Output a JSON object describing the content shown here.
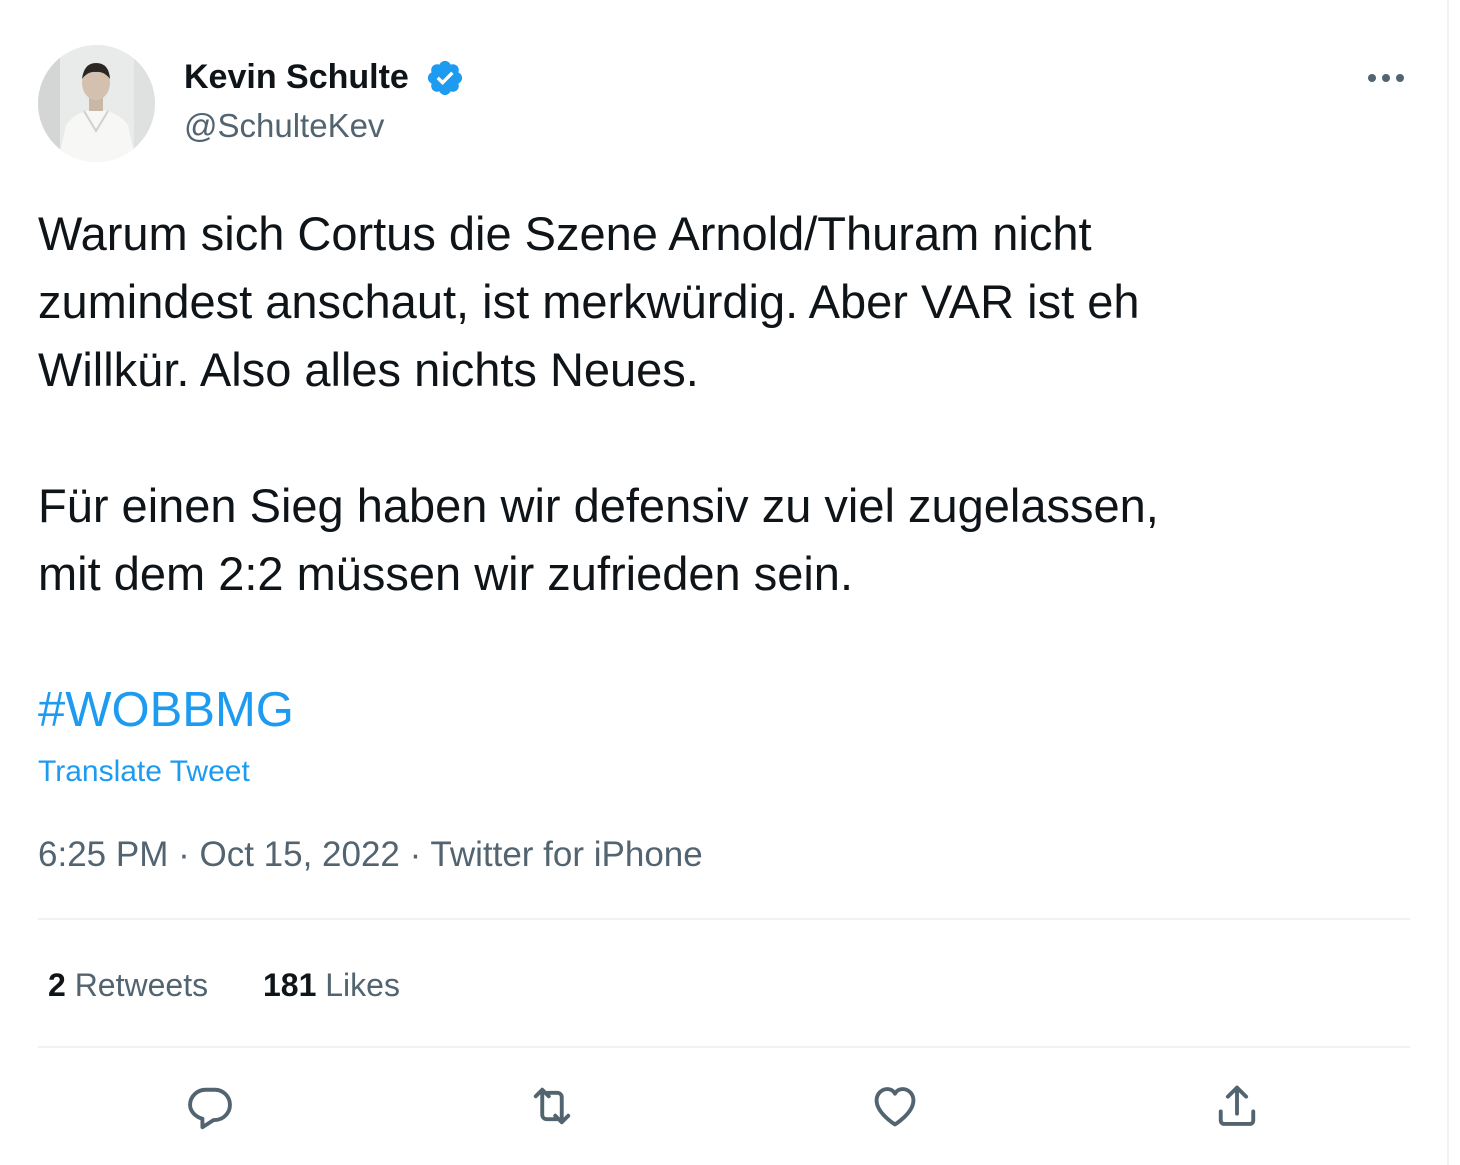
{
  "author": {
    "name": "Kevin Schulte",
    "handle": "@SchulteKev",
    "verified": true,
    "avatar_icon": "profile-photo"
  },
  "tweet": {
    "text": "Warum sich Cortus die Szene Arnold/Thuram nicht\nzumindest anschaut, ist merkwürdig. Aber VAR ist eh\nWillkür. Also alles nichts Neues.\n\nFür einen Sieg haben wir defensiv zu viel zugelassen,\nmit dem 2:2 müssen wir zufrieden sein.",
    "hashtag": "#WOBBMG",
    "translate_label": "Translate Tweet",
    "time": "6:25 PM",
    "date": "Oct 15, 2022",
    "source": "Twitter for iPhone",
    "separator": " · "
  },
  "stats": {
    "retweets_count": "2",
    "retweets_label": "Retweets",
    "likes_count": "181",
    "likes_label": "Likes"
  },
  "actions": [
    "reply-icon",
    "retweet-icon",
    "like-icon",
    "share-icon"
  ],
  "colors": {
    "text_primary": "#0f1419",
    "text_secondary": "#536471",
    "accent": "#1d9bf0",
    "divider": "#eff3f4"
  }
}
